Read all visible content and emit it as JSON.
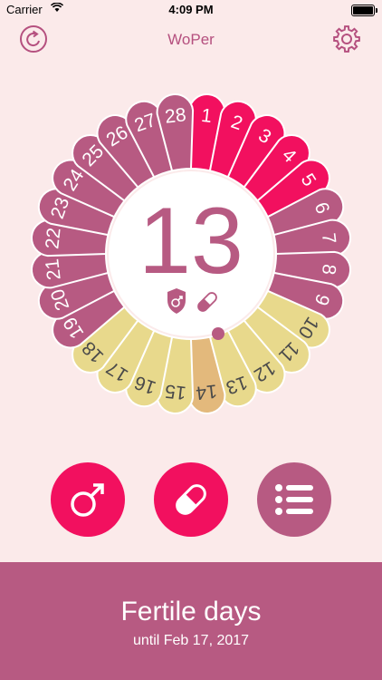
{
  "status": {
    "carrier": "Carrier",
    "time": "4:09 PM"
  },
  "nav": {
    "title": "WoPer",
    "left_icon": "refresh-icon",
    "right_icon": "gear-icon"
  },
  "cycle": {
    "current_day": "13",
    "days": [
      "1",
      "2",
      "3",
      "4",
      "5",
      "6",
      "7",
      "8",
      "9",
      "10",
      "11",
      "12",
      "13",
      "14",
      "15",
      "16",
      "17",
      "18",
      "19",
      "20",
      "21",
      "22",
      "23",
      "24",
      "25",
      "26",
      "27",
      "28"
    ],
    "period_days": [
      1,
      2,
      3,
      4,
      5
    ],
    "fertile_days": [
      10,
      11,
      12,
      13,
      15,
      16,
      17,
      18
    ],
    "ovulation_day": 14,
    "indicator_icons": [
      "shield-male-icon",
      "pill-icon"
    ]
  },
  "colors": {
    "period": "#f2105f",
    "regular": "#b75a82",
    "fertile": "#e8d98c",
    "ovulation": "#e3b97c",
    "background": "#fbeaea",
    "accent": "#f2105f",
    "history": "#b75a82"
  },
  "actions": {
    "sex_icon": "male-symbol-icon",
    "pill_icon": "pill-icon",
    "history_icon": "list-icon"
  },
  "footer": {
    "title": "Fertile days",
    "subtitle": "until Feb 17, 2017"
  }
}
